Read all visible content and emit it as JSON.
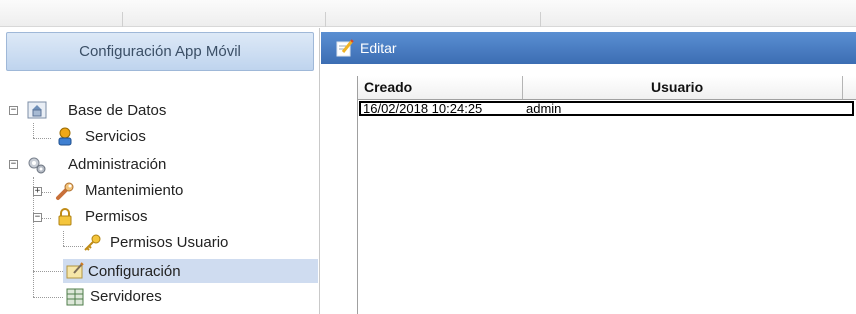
{
  "left_panel": {
    "header": "Configuración App Móvil",
    "tree": [
      {
        "label": "Base de Datos",
        "expander": "−",
        "icon": "database-icon"
      },
      {
        "label": "Servicios",
        "icon": "services-icon"
      },
      {
        "label": "Administración",
        "expander": "−",
        "icon": "gears-icon"
      },
      {
        "label": "Mantenimiento",
        "expander": "+",
        "icon": "wrench-icon"
      },
      {
        "label": "Permisos",
        "expander": "−",
        "icon": "lock-icon"
      },
      {
        "label": "Permisos Usuario",
        "icon": "key-icon"
      },
      {
        "label": "Configuración",
        "icon": "config-icon",
        "selected": true
      },
      {
        "label": "Servidores",
        "icon": "servers-icon"
      }
    ]
  },
  "toolbar": {
    "edit_label": "Editar"
  },
  "grid": {
    "columns": [
      "Creado",
      "Usuario"
    ],
    "rows": [
      {
        "creado": "16/02/2018 10:24:25",
        "usuario": "admin"
      }
    ]
  },
  "colors": {
    "selection": "#cfdcf0",
    "toolbar": "#4a7fc4",
    "header_text": "#3b4f66"
  }
}
